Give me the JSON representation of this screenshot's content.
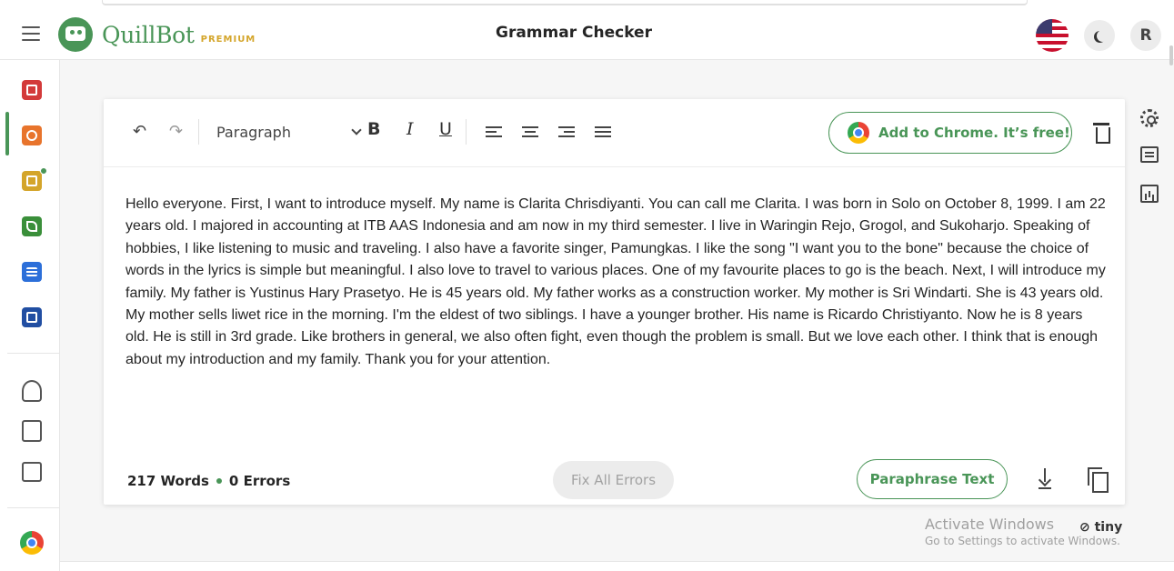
{
  "header": {
    "logo_text": "QuillBot",
    "badge": "PREMIUM",
    "title": "Grammar Checker",
    "avatar_initial": "R"
  },
  "sidebar": {
    "items": [
      {
        "icon": "summarizer-icon",
        "color": "#d33a3a"
      },
      {
        "icon": "grammar-checker-icon",
        "color": "#e8742c"
      },
      {
        "icon": "plagiarism-checker-icon",
        "color": "#d4a52a"
      },
      {
        "icon": "co-writer-icon",
        "color": "#3a8f3a"
      },
      {
        "icon": "summarizer-doc-icon",
        "color": "#2c6fd9"
      },
      {
        "icon": "citation-generator-icon",
        "color": "#214ea2"
      }
    ],
    "active_color": "#499557"
  },
  "toolbar": {
    "paragraph_select": "Paragraph",
    "bold": "B",
    "italic": "I",
    "underline": "U",
    "chrome_button": "Add to Chrome. It’s free!"
  },
  "editor": {
    "text": "Hello everyone. First, I want to introduce myself. My name is Clarita Chrisdiyanti. You can call me Clarita. I was born in Solo on October 8, 1999. I am 22 years old. I majored in accounting at ITB AAS Indonesia and am now in my third semester. I live in Waringin Rejo, Grogol, and Sukoharjo. Speaking of hobbies, I like listening to music and traveling. I also have a favorite singer, Pamungkas. I like the song \"I want you to the bone\" because the choice of words in the lyrics is simple but meaningful. I also love to travel to various places. One of my favourite places to go is the beach. Next, I will introduce my family. My father is Yustinus Hary Prasetyo. He is 45 years old. My father works as a construction worker. My mother is Sri Windarti. She is 43 years old. My mother sells liwet rice in the morning. I'm the eldest of two siblings. I have a younger brother. His name is Ricardo Christiyanto. Now he is 8 years old. He is still in 3rd grade. Like brothers in general, we also often fight, even though the problem is small. But we love each other. I think that is enough about my introduction and my family. Thank you for your attention."
  },
  "footer": {
    "words": "217 Words",
    "errors": "0 Errors",
    "fix_all": "Fix All Errors",
    "paraphrase": "Paraphrase Text"
  },
  "watermark": {
    "line1": "Activate Windows",
    "line2": "Go to Settings to activate Windows.",
    "tiny": "tiny"
  },
  "colors": {
    "brand": "#499557",
    "premium": "#d4a52a"
  }
}
